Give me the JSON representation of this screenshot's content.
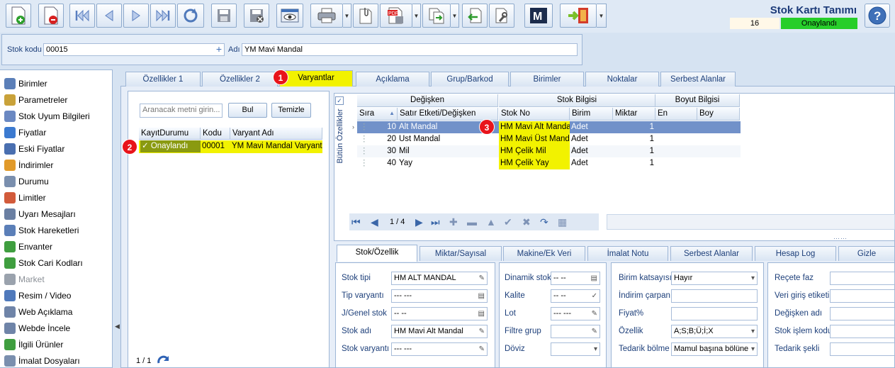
{
  "window": {
    "title": "Stok Kartı Tanımı",
    "record_number": "16",
    "record_status": "Onaylandı"
  },
  "header": {
    "stock_code_label": "Stok kodu",
    "stock_code_value": "00015",
    "name_label": "Adı",
    "name_value": "YM Mavi Mandal"
  },
  "menu": [
    "Birimler",
    "Parametreler",
    "Stok Uyum Bilgileri",
    "Fiyatlar",
    "Eski Fiyatlar",
    "İndirimler",
    "Durumu",
    "Limitler",
    "Uyarı Mesajları",
    "Stok Hareketleri",
    "Envanter",
    "Stok Cari Kodları",
    "Market",
    "Resim / Video",
    "Web Açıklama",
    "Webde İncele",
    "İlgili Ürünler",
    "İmalat Dosyaları"
  ],
  "tabs": [
    "Özellikler 1",
    "Özellikler 2",
    "Varyantlar",
    "Açıklama",
    "Grup/Barkod",
    "Birimler",
    "Noktalar",
    "Serbest Alanlar"
  ],
  "variants": {
    "search_placeholder": "Aranacak metni girin...",
    "find_label": "Bul",
    "clear_label": "Temizle",
    "columns": [
      "KayıtDurumu",
      "Kodu",
      "Varyant Adı"
    ],
    "rows": [
      {
        "status": "Onaylandı",
        "code": "00001",
        "name": "YM Mavi Mandal Varyantı"
      }
    ],
    "pager": "1 / 1"
  },
  "badges": [
    "1",
    "2",
    "3"
  ],
  "grid": {
    "side_label": "Bütün Özellikler",
    "groups": [
      "Değişken",
      "Stok Bilgisi",
      "Boyut Bilgisi"
    ],
    "columns": [
      "Sıra",
      "Satır Etketi/Değişken",
      "Stok No",
      "Birim",
      "Miktar",
      "En",
      "Boy"
    ],
    "rows": [
      {
        "order": "10",
        "label": "Alt Mandal",
        "stock_no": "HM Mavi Alt Mandal",
        "unit": "Adet",
        "qty": "1"
      },
      {
        "order": "20",
        "label": "Ust Mandal",
        "stock_no": "HM Mavi Üst Mandal",
        "unit": "Adet",
        "qty": "1"
      },
      {
        "order": "30",
        "label": "Mil",
        "stock_no": "HM Çelik Mil",
        "unit": "Adet",
        "qty": "1"
      },
      {
        "order": "40",
        "label": "Yay",
        "stock_no": "HM Çelik Yay",
        "unit": "Adet",
        "qty": "1"
      }
    ],
    "pager": "1 / 4"
  },
  "bottom_tabs": [
    "Stok/Özellik",
    "Miktar/Sayısal",
    "Makine/Ek Veri",
    "İmalat Notu",
    "Serbest Alanlar",
    "Hesap Log",
    "Gizle"
  ],
  "fields": {
    "col1": [
      {
        "label": "Stok tipi",
        "value": "HM ALT MANDAL"
      },
      {
        "label": "Tip varyantı",
        "value": "--- ---"
      },
      {
        "label": "J/Genel stok",
        "value": "-- --"
      },
      {
        "label": "Stok adı",
        "value": "HM Mavi Alt Mandal"
      },
      {
        "label": "Stok varyantı",
        "value": "--- ---"
      }
    ],
    "col2": [
      {
        "label": "Dinamik stok",
        "value": "-- --"
      },
      {
        "label": "Kalite",
        "value": "-- --"
      },
      {
        "label": "Lot",
        "value": "--- ---"
      },
      {
        "label": "Filtre grup",
        "value": ""
      },
      {
        "label": "Döviz",
        "value": ""
      }
    ],
    "col3": [
      {
        "label": "Birim katsayısı",
        "value": "Hayır"
      },
      {
        "label": "İndirim çarpanı",
        "value": ""
      },
      {
        "label": "Fiyat%",
        "value": ""
      },
      {
        "label": "Özellik",
        "value": "A;S;B;Ü;İ;X"
      },
      {
        "label": "Tedarik bölme",
        "value": "Mamul başına bölüne"
      }
    ],
    "col4": [
      {
        "label": "Reçete faz",
        "value": ""
      },
      {
        "label": "Veri giriş etiketi",
        "value": ""
      },
      {
        "label": "Değişken adı",
        "value": ""
      },
      {
        "label": "Stok işlem kodu",
        "value": ""
      },
      {
        "label": "Tedarik şekli",
        "value": ""
      }
    ]
  },
  "colors": {
    "accent_yellow": "#f2f200",
    "status_green": "#27ce2a",
    "selection_blue": "#7191c9",
    "badge_red": "#e8141b"
  }
}
